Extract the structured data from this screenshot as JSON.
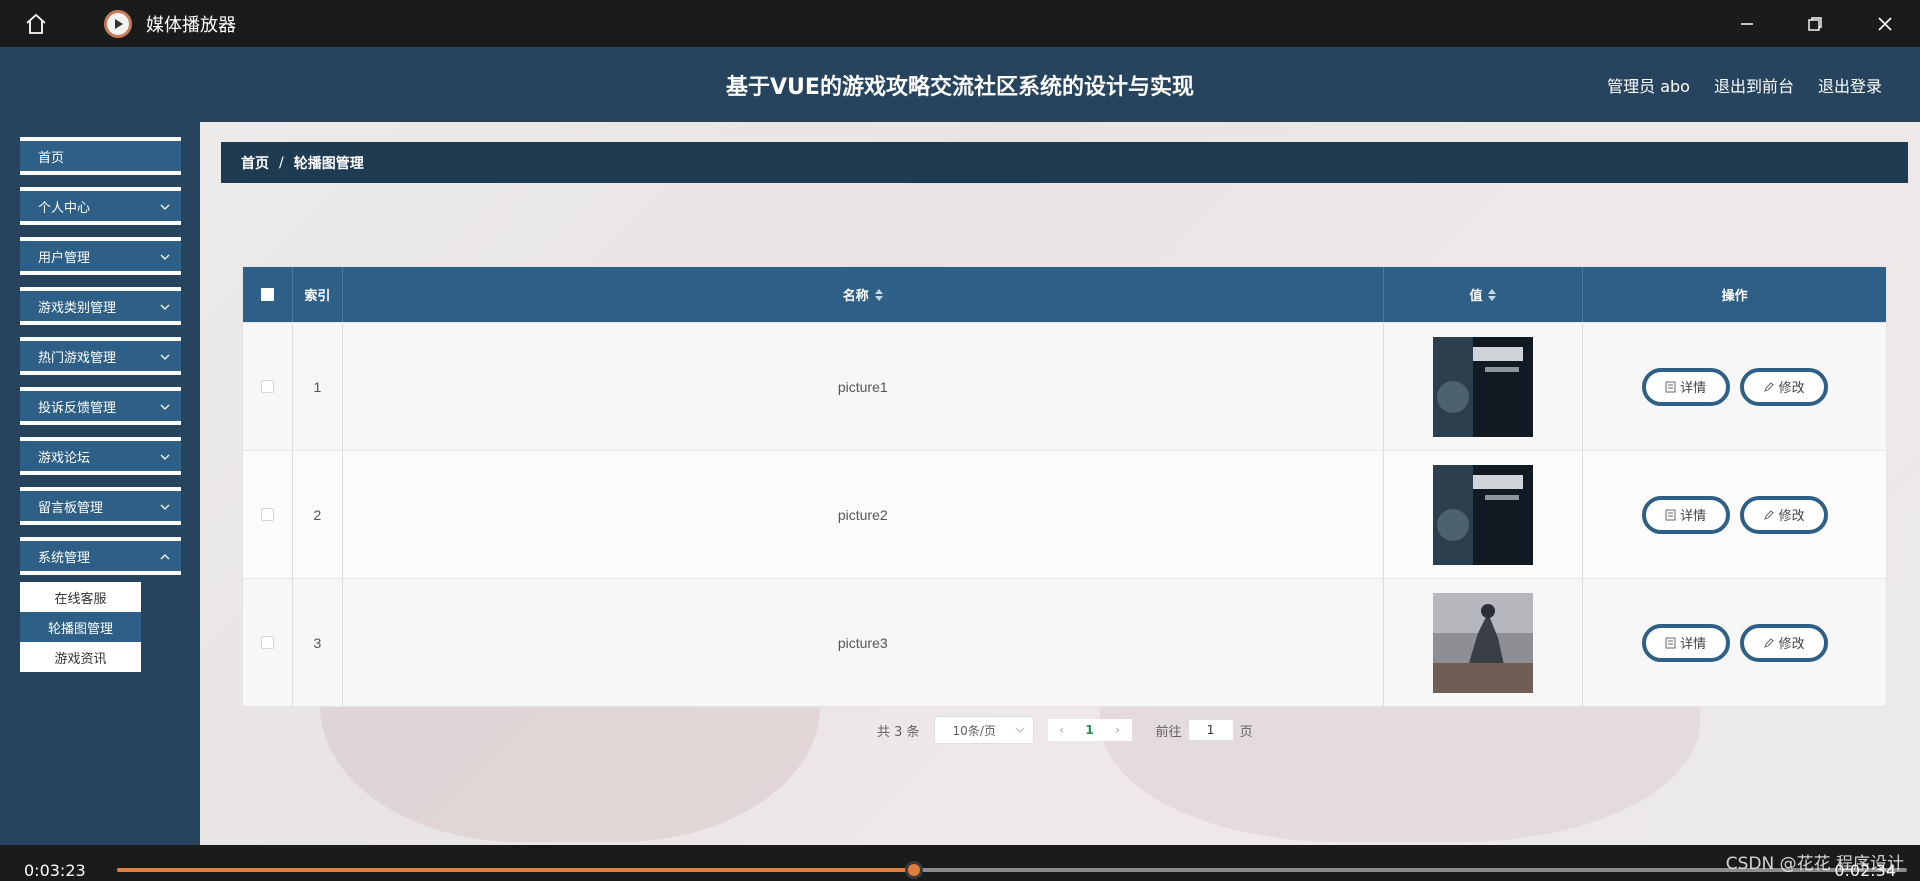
{
  "player": {
    "title": "媒体播放器",
    "current_time": "0:03:23",
    "total_time": "0:02:34",
    "progress": 0.445
  },
  "header": {
    "title": "基于VUE的游戏攻略交流社区系统的设计与实现",
    "admin": "管理员 abo",
    "to_front": "退出到前台",
    "logout": "退出登录"
  },
  "sidebar": {
    "items": [
      {
        "label": "首页"
      },
      {
        "label": "个人中心"
      },
      {
        "label": "用户管理"
      },
      {
        "label": "游戏类别管理"
      },
      {
        "label": "热门游戏管理"
      },
      {
        "label": "投诉反馈管理"
      },
      {
        "label": "游戏论坛"
      },
      {
        "label": "留言板管理"
      },
      {
        "label": "系统管理"
      }
    ],
    "submenu": [
      {
        "label": "在线客服"
      },
      {
        "label": "轮播图管理"
      },
      {
        "label": "游戏资讯"
      }
    ]
  },
  "breadcrumb": {
    "home": "首页",
    "separator": "/",
    "current": "轮播图管理"
  },
  "table": {
    "headers": {
      "index": "索引",
      "name": "名称",
      "value": "值",
      "ops": "操作"
    },
    "rows": [
      {
        "index": "1",
        "name": "picture1",
        "detail": "详情",
        "edit": "修改"
      },
      {
        "index": "2",
        "name": "picture2",
        "detail": "详情",
        "edit": "修改"
      },
      {
        "index": "3",
        "name": "picture3",
        "detail": "详情",
        "edit": "修改"
      }
    ]
  },
  "pagination": {
    "total": "共 3 条",
    "page_size": "10条/页",
    "current_page": "1",
    "goto_label": "前往",
    "goto_value": "1",
    "page_unit": "页"
  },
  "watermark": "CSDN @花花 程序设计",
  "colors": {
    "accent": "#2e5f86",
    "header": "#27445e",
    "progress": "#e37d3d"
  }
}
